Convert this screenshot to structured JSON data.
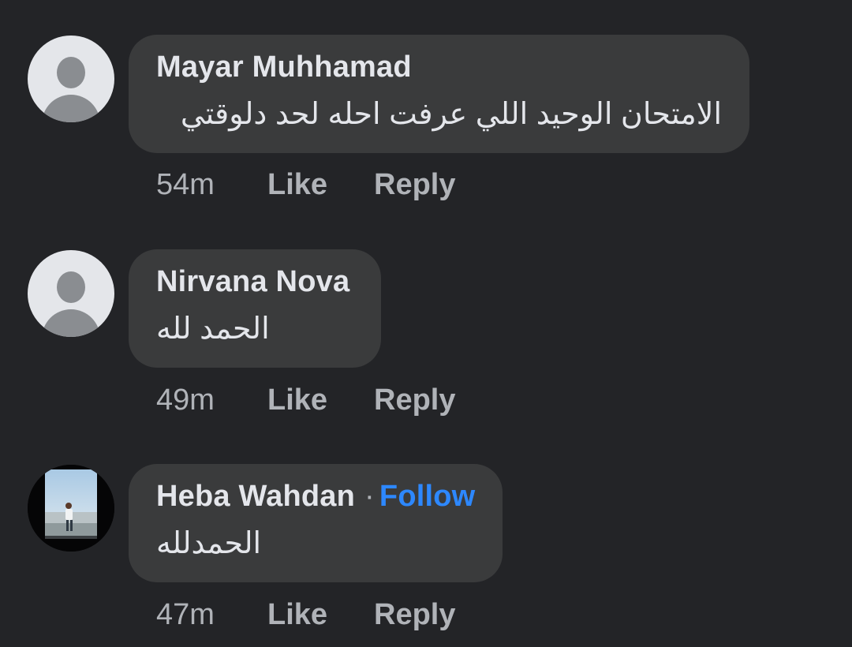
{
  "comments": [
    {
      "author": "Mayar Muhhamad",
      "text": "الامتحان الوحيد اللي عرفت احله لحد دلوقتي",
      "time": "54m",
      "like_label": "Like",
      "reply_label": "Reply",
      "avatar": "default-avatar-icon"
    },
    {
      "author": "Nirvana Nova",
      "text": "الحمد لله",
      "time": "49m",
      "like_label": "Like",
      "reply_label": "Reply",
      "avatar": "default-avatar-icon"
    },
    {
      "author": "Heba Wahdan",
      "separator": "·",
      "follow_label": "Follow",
      "text": "الحمدلله",
      "time": "47m",
      "like_label": "Like",
      "reply_label": "Reply",
      "avatar": "photo"
    }
  ],
  "colors": {
    "background": "#232427",
    "bubble": "#3a3b3c",
    "primary_text": "#e4e6eb",
    "secondary_text": "#b0b3b8",
    "follow_link": "#2d88ff"
  }
}
